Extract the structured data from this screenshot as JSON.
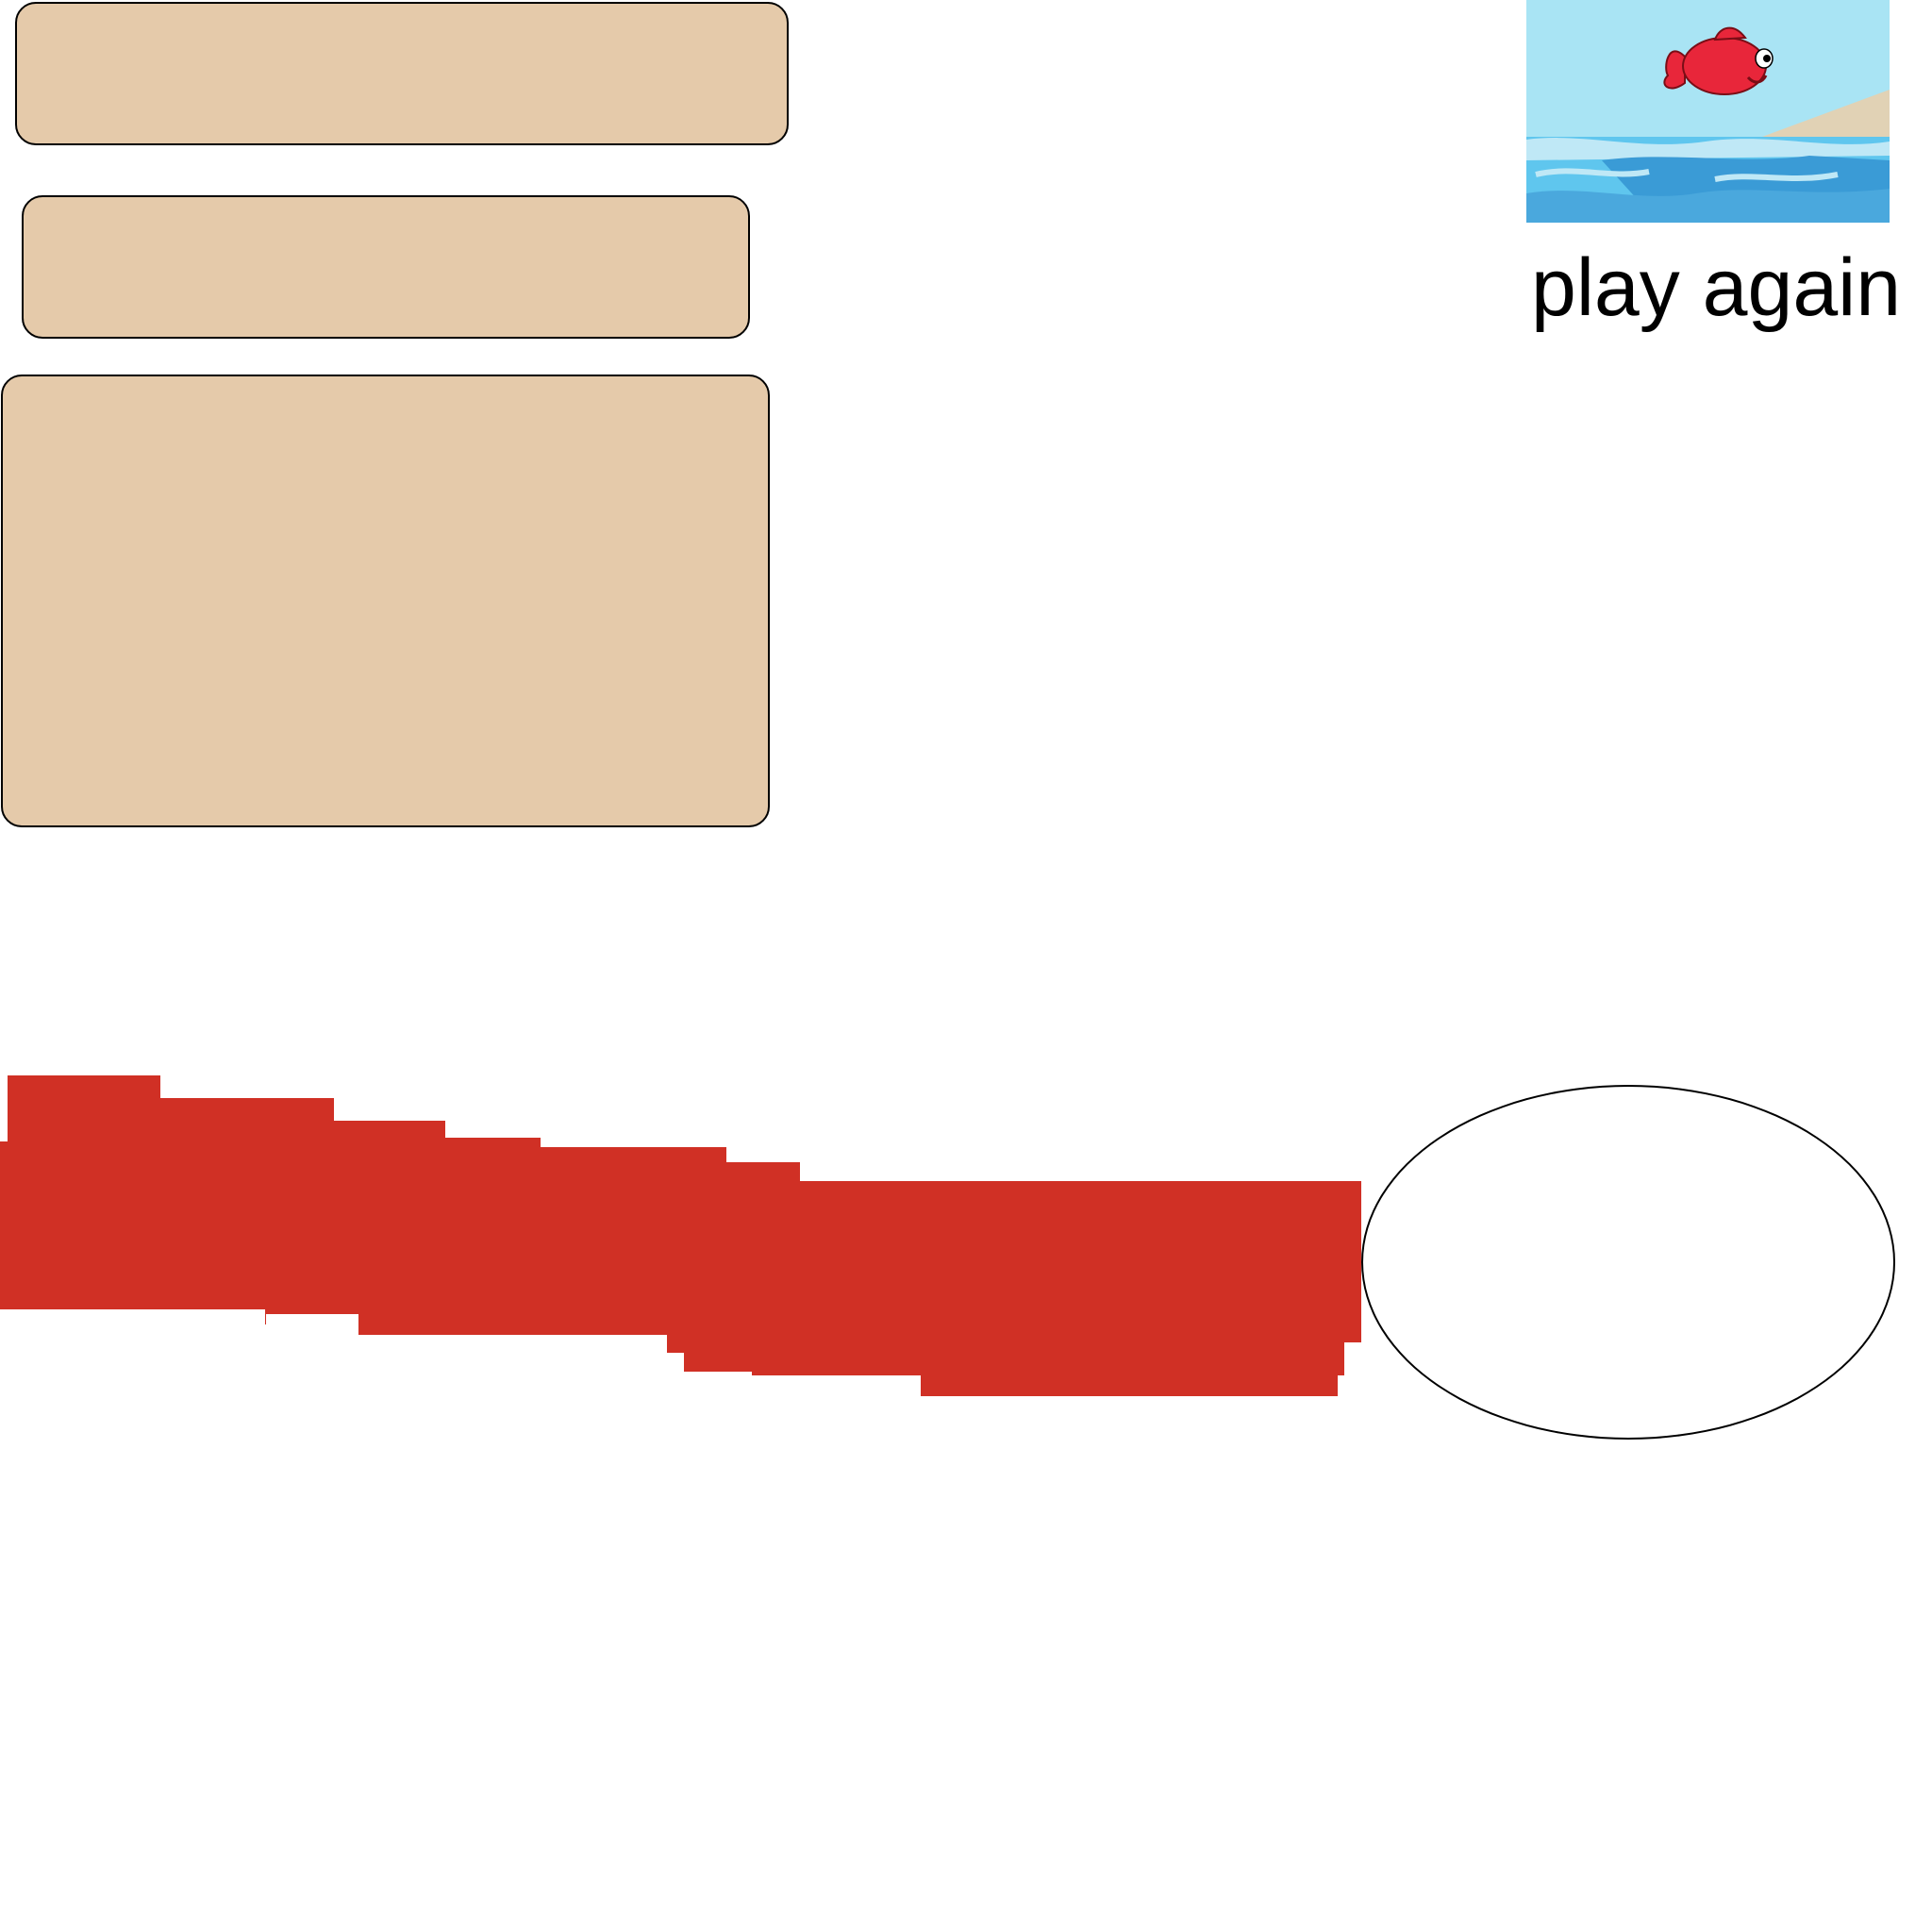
{
  "play_again": {
    "label": "play again",
    "thumbnail_icon": "goldfish-ocean-icon"
  },
  "colors": {
    "panel_fill": "#e5caaa",
    "red_bar": "#d03025",
    "sky": "#a9e4f4",
    "water_light": "#5fc6ee",
    "water_dark": "#3a9bd6",
    "fish": "#e8263a"
  }
}
